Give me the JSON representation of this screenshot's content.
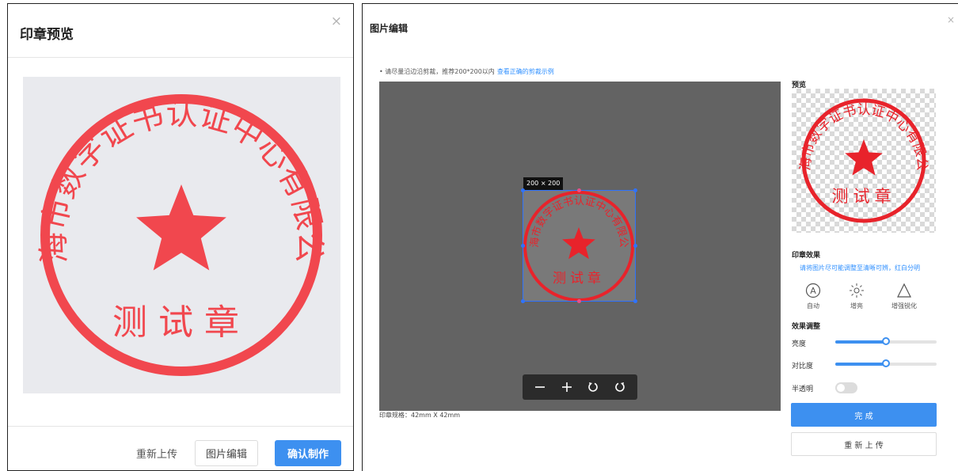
{
  "preview_dialog": {
    "title": "印章预览",
    "close_symbol": "×",
    "stamp": {
      "company_name": "上海市数字证书认证中心有限公司",
      "center_text": "测试章",
      "color": "#f1474e"
    },
    "buttons": {
      "reupload": "重新上传",
      "edit_image": "图片编辑",
      "confirm": "确认制作"
    }
  },
  "edit_dialog": {
    "title": "图片编辑",
    "close_symbol": "×",
    "hint": {
      "text": "• 请尽量沿边沿剪裁，推荐200*200以内",
      "link": "查看正确的剪裁示例"
    },
    "crop": {
      "size_label": "200 × 200"
    },
    "toolbar": [
      {
        "icon": "zoom-out-icon"
      },
      {
        "icon": "zoom-in-icon"
      },
      {
        "icon": "rotate-left-icon"
      },
      {
        "icon": "rotate-right-icon"
      }
    ],
    "spec_text": "印章规格：42mm X 42mm",
    "preview_label": "预览",
    "effects": {
      "title": "印章效果",
      "hint": "请将图片尽可能调整至清晰可辨，红白分明",
      "items": [
        {
          "label": "自动",
          "icon": "auto-a-icon"
        },
        {
          "label": "增亮",
          "icon": "brightness-sun-icon"
        },
        {
          "label": "增强锐化",
          "icon": "sharpen-triangle-icon"
        }
      ]
    },
    "adjust": {
      "title": "效果调整",
      "brightness": {
        "label": "亮度",
        "value": 0.5
      },
      "contrast": {
        "label": "对比度",
        "value": 0.5
      },
      "translucent": {
        "label": "半透明",
        "on": false
      }
    },
    "buttons": {
      "done": "完 成",
      "reupload": "重 新 上 传"
    },
    "accent_color": "#3d90f0"
  }
}
